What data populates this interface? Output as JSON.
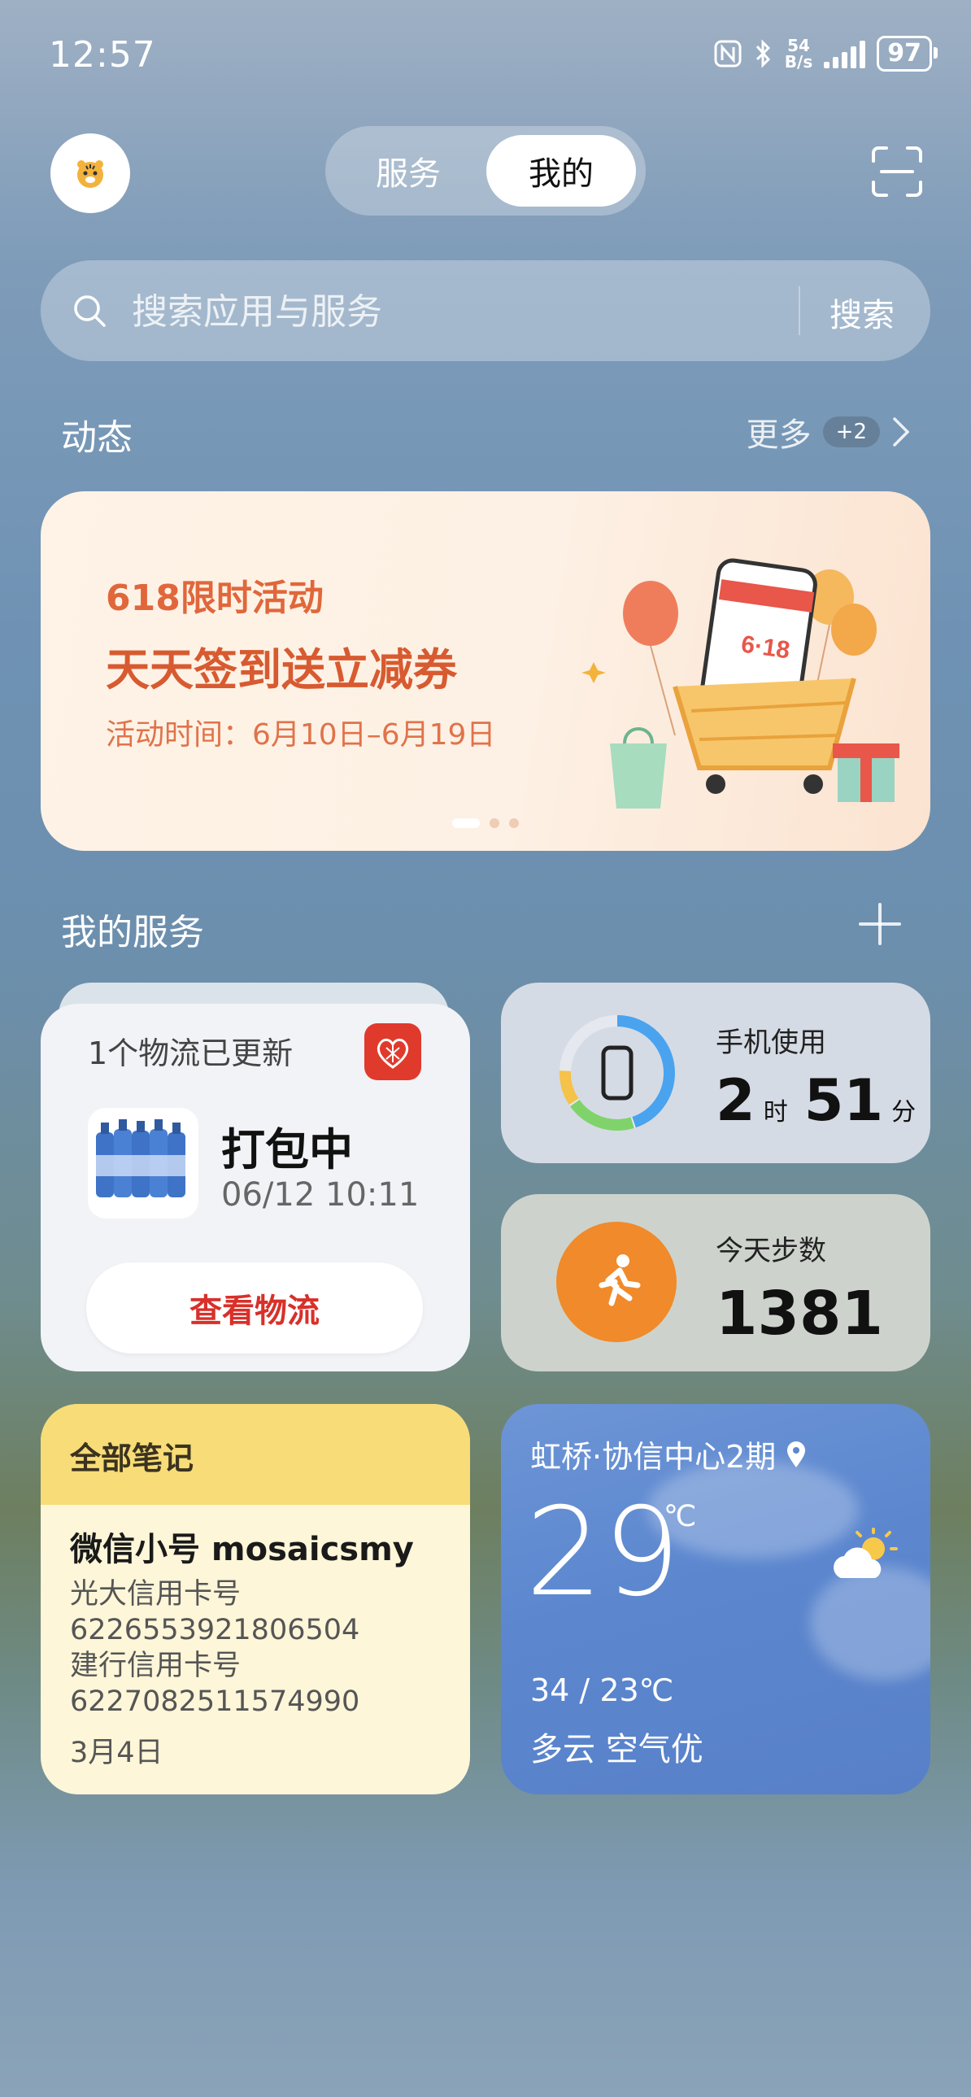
{
  "status_bar": {
    "time": "12:57",
    "net_speed": "54",
    "net_unit": "B/s",
    "battery": "97"
  },
  "header": {
    "tabs": [
      "服务",
      "我的"
    ],
    "active_tab": "我的"
  },
  "search": {
    "placeholder": "搜索应用与服务",
    "button_label": "搜索"
  },
  "feed": {
    "title": "动态",
    "more_label": "更多",
    "more_badge": "+2"
  },
  "banner": {
    "line1": "618限时活动",
    "line2": "天天签到送立减券",
    "line3": "活动时间：6月10日–6月19日",
    "phone_label": "6·18"
  },
  "services": {
    "title": "我的服务",
    "logistics": {
      "header": "1个物流已更新",
      "status": "打包中",
      "time": "06/12 10:11",
      "button_label": "查看物流"
    },
    "phone_usage": {
      "label": "手机使用",
      "hours": "2",
      "hours_unit": "时",
      "minutes": "51",
      "minutes_unit": "分"
    },
    "steps": {
      "label": "今天步数",
      "value": "1381"
    },
    "notes": {
      "title": "全部笔记",
      "subtitle": "微信小号  mosaicsmy",
      "lines": [
        "光大信用卡号",
        "6226553921806504",
        "建行信用卡号",
        "6227082511574990"
      ],
      "date": "3月4日"
    },
    "weather": {
      "location": "虹桥·协信中心2期",
      "temp": "29",
      "unit": "℃",
      "range": "34 / 23℃",
      "condition": "多云 空气优"
    }
  },
  "colors": {
    "accent_red": "#d8302a",
    "banner_orange": "#d85a30",
    "steps_orange": "#f08a2a",
    "notes_yellow": "#f7dc77",
    "weather_blue": "#5c87cf"
  }
}
